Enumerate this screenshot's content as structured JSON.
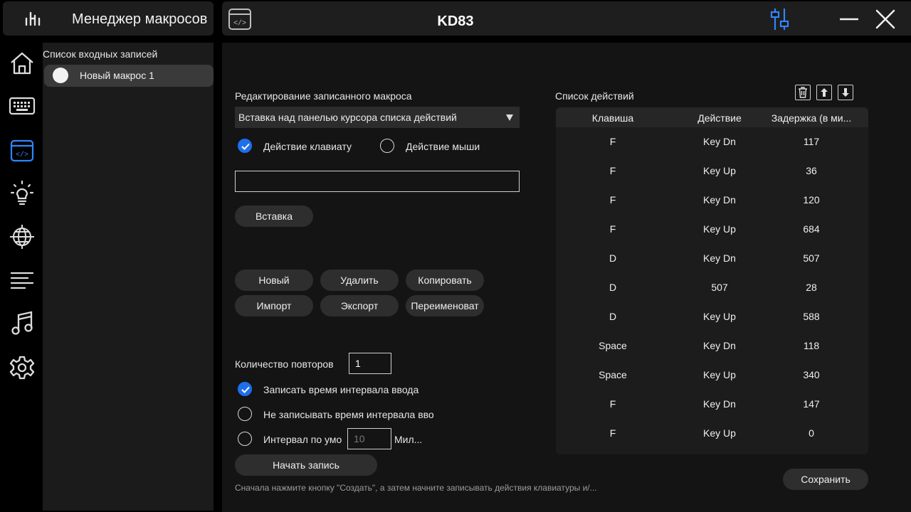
{
  "brand": {
    "title": "Менеджер макросов",
    "logo_icon": "brand-logo-icon"
  },
  "topbar": {
    "device_name": "KD83"
  },
  "nav": [
    {
      "name": "home",
      "icon": "home-icon"
    },
    {
      "name": "keyboard",
      "icon": "keyboard-icon"
    },
    {
      "name": "macro",
      "icon": "macro-code-icon",
      "active": true
    },
    {
      "name": "lighting",
      "icon": "lightbulb-icon"
    },
    {
      "name": "network",
      "icon": "globe-icon"
    },
    {
      "name": "list",
      "icon": "lines-icon"
    },
    {
      "name": "music",
      "icon": "music-note-icon"
    },
    {
      "name": "settings",
      "icon": "gear-icon"
    }
  ],
  "records": {
    "title": "Список входных записей",
    "items": [
      {
        "label": "Новый макрос 1"
      }
    ]
  },
  "editor": {
    "title": "Редактирование записанного макроса",
    "dropdown_value": "Вставка над панелью курсора списка действий",
    "keyboard_action_label": "Действие клавиату",
    "mouse_action_label": "Действие мыши",
    "input_value": "",
    "insert_label": "Вставка"
  },
  "macro_buttons": {
    "new": "Новый",
    "delete": "Удалить",
    "copy": "Копировать",
    "import": "Импорт",
    "export": "Экспорт",
    "rename": "Переименоват"
  },
  "repeat": {
    "label": "Количество повторов",
    "value": "1"
  },
  "timing": {
    "record_interval": "Записать время интервала ввода",
    "no_record_interval": "Не записывать время интервала вво",
    "default_interval": "Интервал по умо",
    "default_interval_value": "10",
    "unit": "Мил..."
  },
  "start_recording": "Начать запись",
  "footer_note": "Сначала нажмите кнопку \"Создать\", а затем начните записывать действия клавиатуры и/...",
  "save_label": "Сохранить",
  "actions": {
    "title": "Список действий",
    "columns": [
      "Клавиша",
      "Действие",
      "Задержка (в ми..."
    ],
    "rows": [
      {
        "key": "F",
        "action": "Key Dn",
        "delay": "117"
      },
      {
        "key": "F",
        "action": "Key Up",
        "delay": "36"
      },
      {
        "key": "F",
        "action": "Key Dn",
        "delay": "120"
      },
      {
        "key": "F",
        "action": "Key Up",
        "delay": "684"
      },
      {
        "key": "D",
        "action": "Key Dn",
        "delay": "507"
      },
      {
        "key": "D",
        "action": "507",
        "delay": "28"
      },
      {
        "key": "D",
        "action": "Key Up",
        "delay": "588"
      },
      {
        "key": "Space",
        "action": "Key Dn",
        "delay": "118"
      },
      {
        "key": "Space",
        "action": "Key Up",
        "delay": "340"
      },
      {
        "key": "F",
        "action": "Key Dn",
        "delay": "147"
      },
      {
        "key": "F",
        "action": "Key Up",
        "delay": "0"
      }
    ]
  },
  "colors": {
    "accent": "#1f6feb",
    "panel": "#1b1b1b",
    "bg": "#000000"
  }
}
